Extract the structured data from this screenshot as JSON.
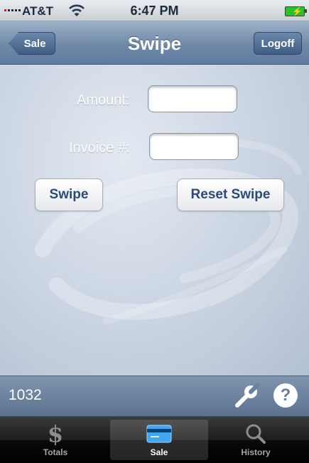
{
  "status_bar": {
    "carrier": "AT&T",
    "time": "6:47 PM",
    "wifi_icon": "wifi-icon",
    "battery_icon": "battery-charging-icon"
  },
  "nav": {
    "back_label": "Sale",
    "title": "Swipe",
    "logoff_label": "Logoff"
  },
  "form": {
    "amount_label": "Amount:",
    "amount_value": "",
    "invoice_label": "Invoice #:",
    "invoice_value": "",
    "swipe_label": "Swipe",
    "reset_label": "Reset Swipe"
  },
  "toolbar": {
    "count": "1032",
    "settings_icon": "wrench-icon",
    "help_icon": "help-icon",
    "help_glyph": "?"
  },
  "tabs": [
    {
      "label": "Totals",
      "icon": "dollar-icon",
      "glyph": "$",
      "selected": false
    },
    {
      "label": "Sale",
      "icon": "credit-card-icon",
      "selected": true
    },
    {
      "label": "History",
      "icon": "magnifier-icon",
      "selected": false
    }
  ],
  "colors": {
    "nav_blue": "#6f89a8",
    "button_text": "#2c4a79",
    "battery_green": "#2ac12a"
  }
}
